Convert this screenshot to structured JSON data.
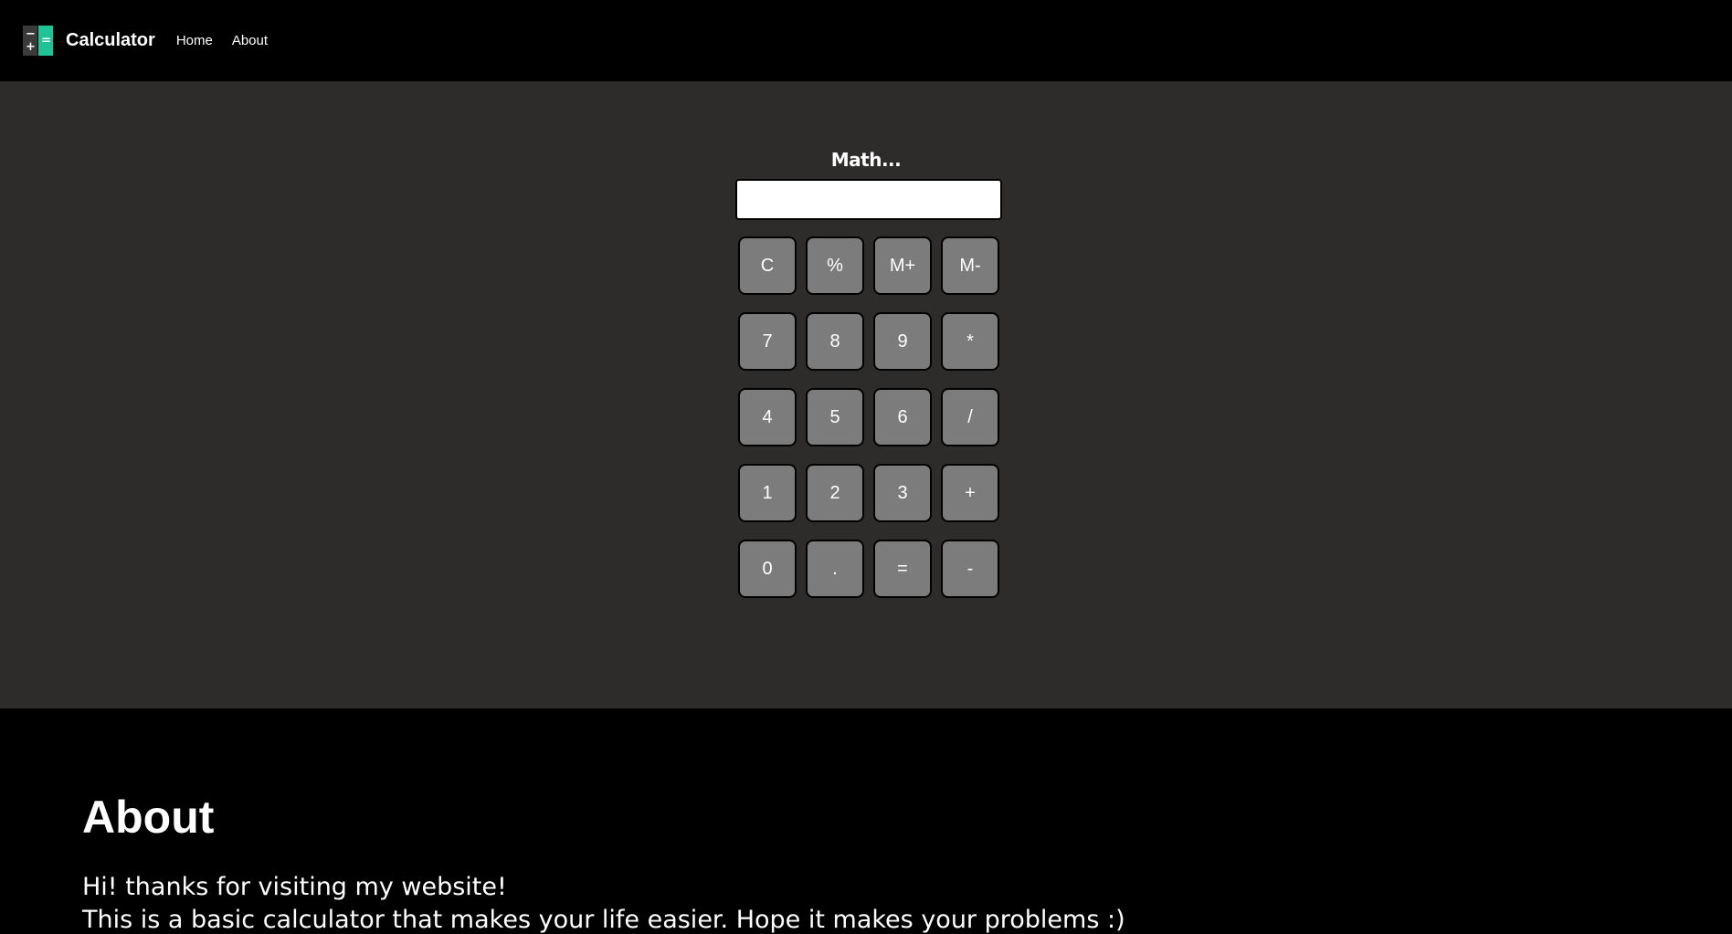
{
  "navbar": {
    "logo_glyphs": {
      "minus": "−",
      "plus": "+",
      "equals": "="
    },
    "brand": "Calculator",
    "links": [
      "Home",
      "About"
    ]
  },
  "calculator": {
    "title": "Math...",
    "display_value": "",
    "keys": [
      "C",
      "%",
      "M+",
      "M-",
      "7",
      "8",
      "9",
      "*",
      "4",
      "5",
      "6",
      "/",
      "1",
      "2",
      "3",
      "+",
      "0",
      ".",
      "=",
      "-"
    ]
  },
  "about": {
    "heading": "About",
    "line1": "Hi! thanks for visiting my website!",
    "line2": "This is a basic calculator that makes your life easier. Hope it makes your problems :)"
  },
  "colors": {
    "accent": "#1fc396",
    "calc_bg": "#2e2b2b",
    "key_bg": "#7c7c7c"
  }
}
